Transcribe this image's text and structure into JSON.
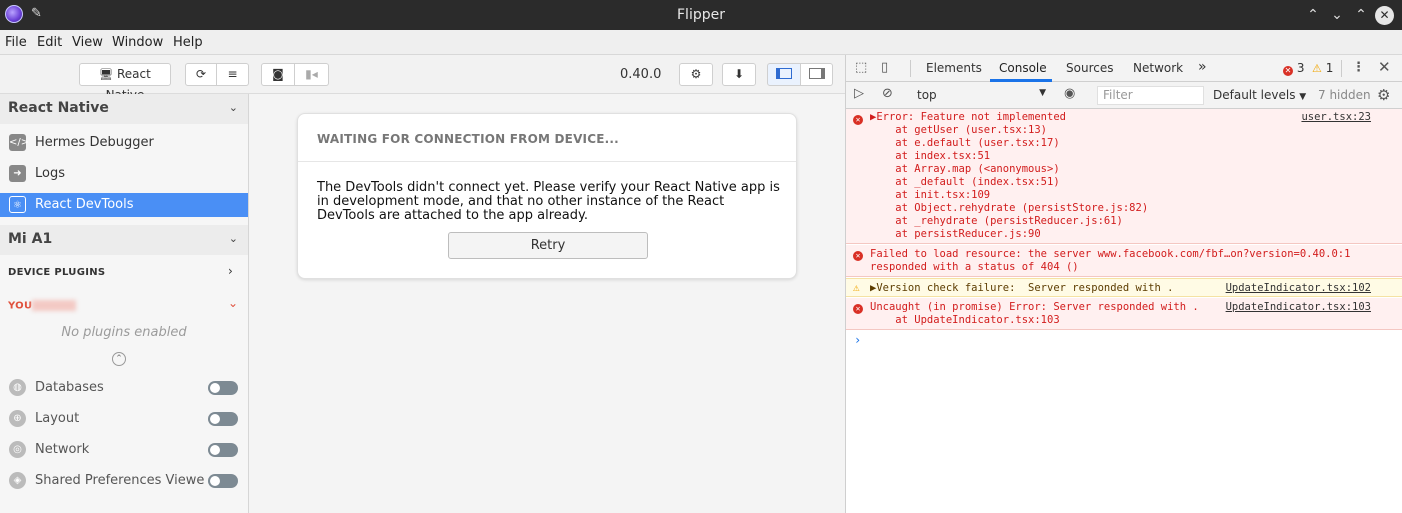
{
  "window": {
    "title": "Flipper",
    "app_icon": "flipper-logo-icon",
    "pin_icon": "pin-icon",
    "buttons": [
      "⌃⌃",
      "⌄",
      "⌃",
      "✕"
    ]
  },
  "menubar": {
    "items": [
      "File",
      "Edit",
      "View",
      "Window",
      "Help"
    ]
  },
  "toolbar": {
    "device_label": "React Native",
    "version": "0.40.0"
  },
  "sidebar": {
    "app_section": {
      "title": "React Native",
      "items": [
        {
          "label": "Hermes Debugger",
          "icon": "code-icon"
        },
        {
          "label": "Logs",
          "icon": "arrow-right-icon"
        },
        {
          "label": "React DevTools",
          "icon": "react-icon",
          "active": true
        }
      ]
    },
    "device_section": {
      "title": "Mi A1",
      "device_plugins_label": "DEVICE PLUGINS",
      "app_label": "YOU",
      "no_plugins": "No plugins enabled",
      "plugins": [
        {
          "label": "Databases",
          "icon": "database-icon",
          "enabled": false
        },
        {
          "label": "Layout",
          "icon": "layout-icon",
          "enabled": false
        },
        {
          "label": "Network",
          "icon": "network-icon",
          "enabled": false
        },
        {
          "label": "Shared Preferences Viewe",
          "icon": "box-icon",
          "enabled": false
        }
      ]
    }
  },
  "main": {
    "card_title": "WAITING FOR CONNECTION FROM DEVICE...",
    "card_text": "The DevTools didn't connect yet. Please verify your React Native app is in development mode, and that no other instance of the React DevTools are attached to the app already.",
    "retry_label": "Retry"
  },
  "devtools": {
    "tabs": [
      "Elements",
      "Console",
      "Sources",
      "Network"
    ],
    "active_tab": "Console",
    "more_tabs": "»",
    "error_count": "3",
    "warning_count": "1",
    "context": "top",
    "filter_placeholder": "Filter",
    "levels": "Default levels",
    "hidden": "7 hidden",
    "console_messages": [
      {
        "type": "error",
        "lines": [
          "▶Error: Feature not implemented",
          "    at getUser (user.tsx:13)",
          "    at e.default (user.tsx:17)",
          "    at index.tsx:51",
          "    at Array.map (<anonymous>)",
          "    at _default (index.tsx:51)",
          "    at init.tsx:109",
          "    at Object.rehydrate (persistStore.js:82)",
          "    at _rehydrate (persistReducer.js:61)",
          "    at persistReducer.js:90"
        ],
        "source": "user.tsx:23"
      },
      {
        "type": "error",
        "lines": [
          "Failed to load resource: the server www.facebook.com/fbf…on?version=0.40.0:1",
          "responded with a status of 404 ()"
        ],
        "source": ""
      },
      {
        "type": "warn",
        "lines": [
          "▶Version check failure:  Server responded with ."
        ],
        "source": "UpdateIndicator.tsx:102"
      },
      {
        "type": "error",
        "lines": [
          "Uncaught (in promise) Error: Server responded with .",
          "    at UpdateIndicator.tsx:103"
        ],
        "source": "UpdateIndicator.tsx:103"
      }
    ],
    "prompt": "›"
  },
  "colors": {
    "accent": "#4a8ff5",
    "error_bg": "#fff0f0",
    "error_text": "#d21c1c",
    "warn_bg": "#fffbe5",
    "devtools_accent": "#1a73e8"
  }
}
